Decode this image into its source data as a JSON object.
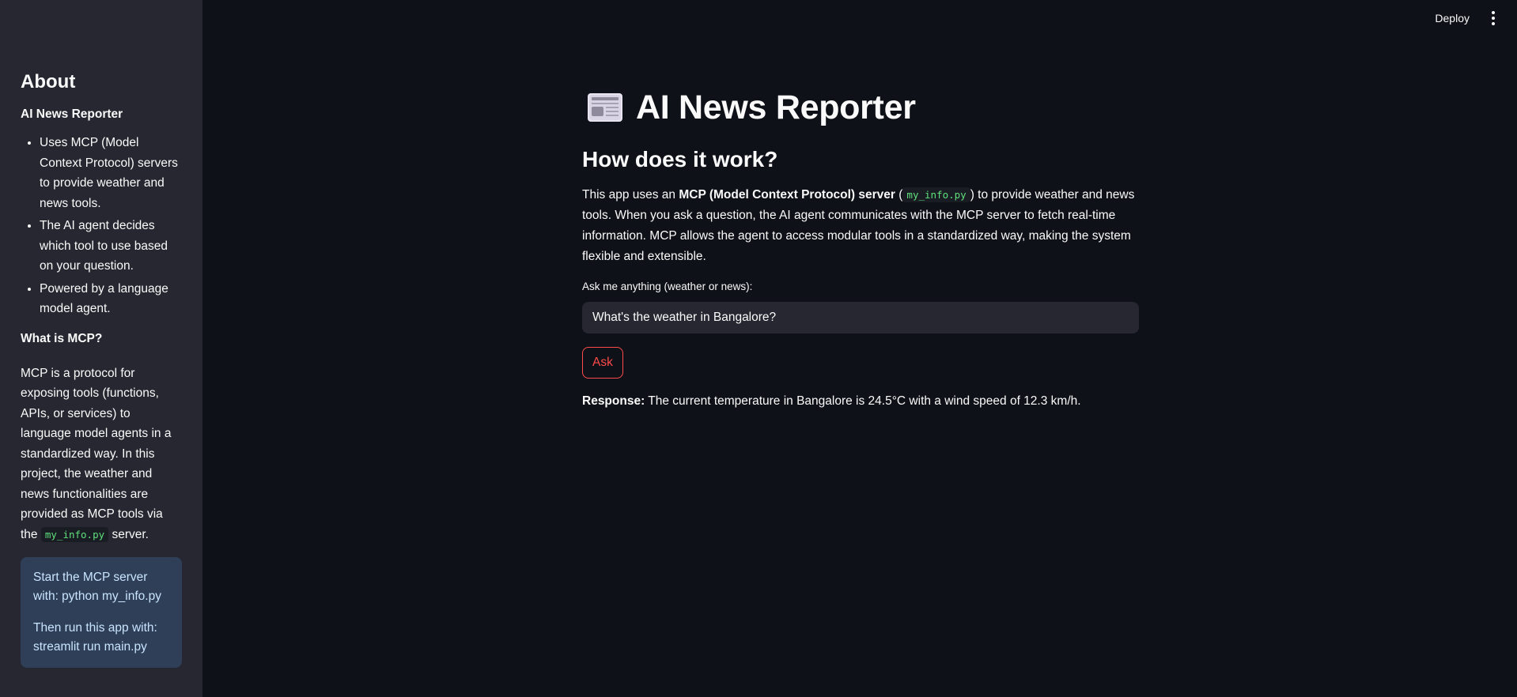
{
  "topbar": {
    "deploy_label": "Deploy",
    "menu_icon": "vertical-ellipsis-icon"
  },
  "sidebar": {
    "title": "About",
    "subtitle": "AI News Reporter",
    "bullets": [
      "Uses MCP (Model Context Protocol) servers to provide weather and news tools.",
      "The AI agent decides which tool to use based on your question.",
      "Powered by a language model agent."
    ],
    "mcp_heading": "What is MCP?",
    "mcp_para_text": "MCP is a protocol for exposing tools (functions, APIs, or services) to language model agents in a standardized way. In this project, the weather and news functionalities are provided as MCP tools via the",
    "mcp_para_code": "my_info.py",
    "mcp_para_end": "server.",
    "info_box": {
      "line1": "Start the MCP server with: python my_info.py",
      "line2": "Then run this app with: streamlit run main.py"
    }
  },
  "main": {
    "title_icon": "newspaper-icon",
    "title": "AI News Reporter",
    "how_heading": "How does it work?",
    "desc": {
      "part1": "This app uses an ",
      "bold": "MCP (Model Context Protocol) server",
      "part2": " (",
      "code": "my_info.py",
      "part3": ") to provide weather and news tools. When you ask a question, the AI agent communicates with the MCP server to fetch real-time information. MCP allows the agent to access modular tools in a standardized way, making the system flexible and extensible."
    },
    "input_label": "Ask me anything (weather or news):",
    "input_value": "What's the weather in Bangalore?",
    "ask_label": "Ask",
    "response_label": "Response:",
    "response_text": "The current temperature in Bangalore is 24.5°C with a wind speed of 12.3 km/h."
  },
  "colors": {
    "background": "#0e1117",
    "sidebar": "#262730",
    "accent": "#ff4b4b",
    "info_box": "#2e3f57",
    "code_text": "#5ee07a"
  }
}
